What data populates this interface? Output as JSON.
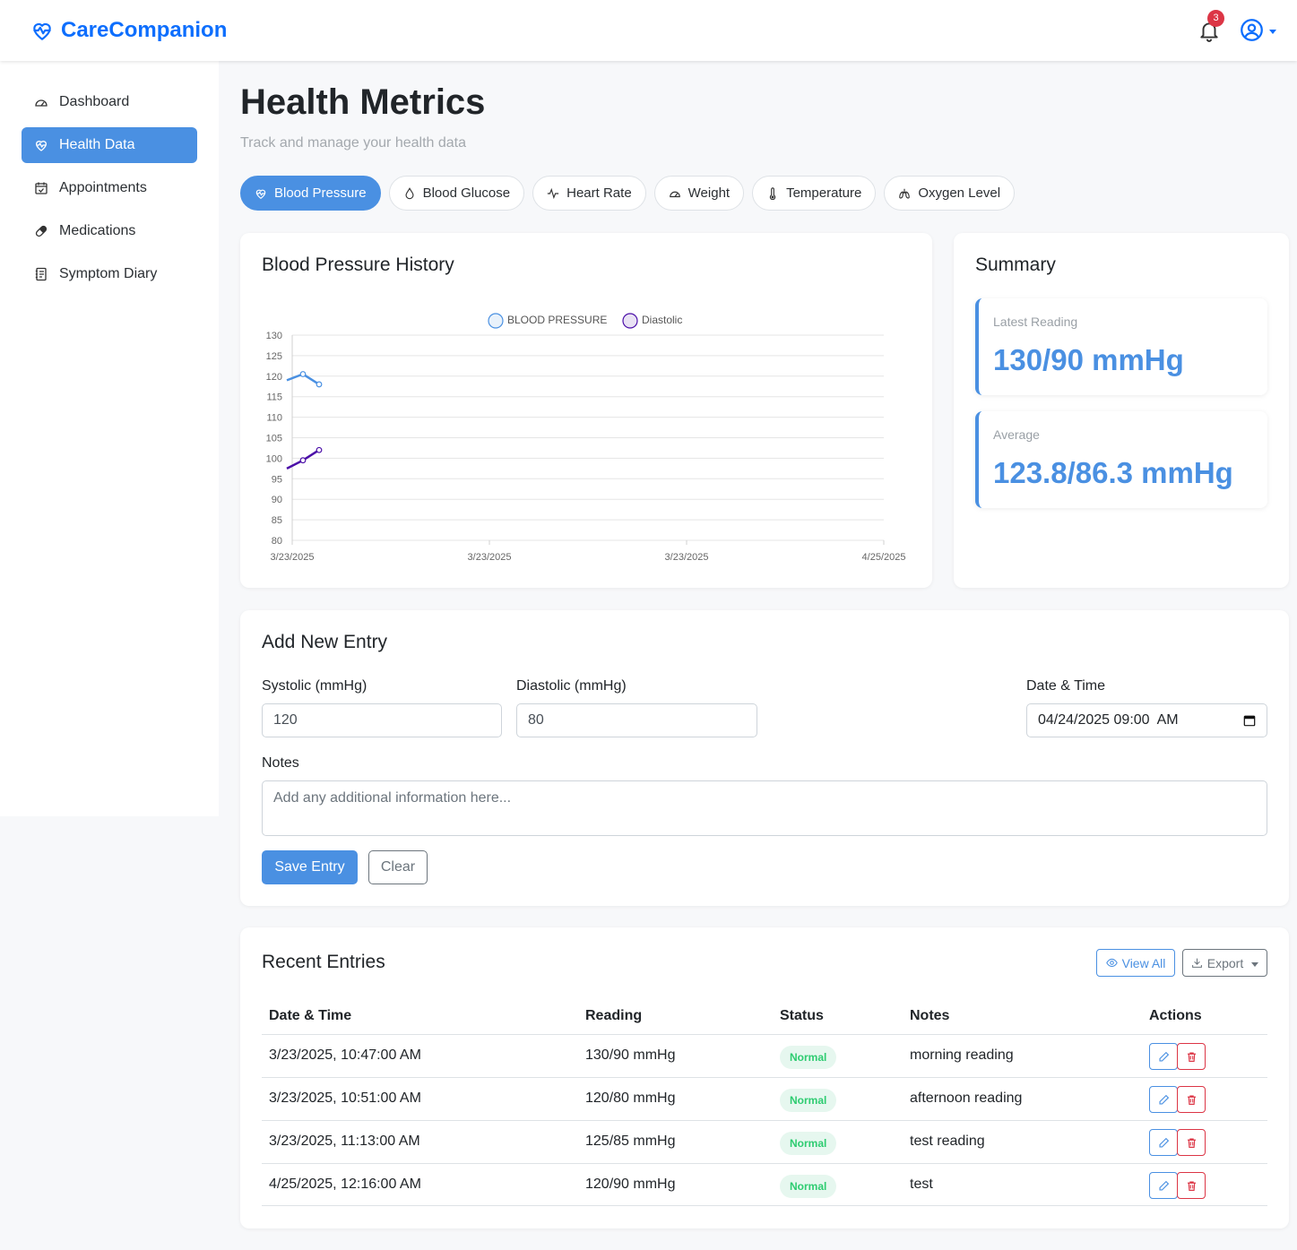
{
  "app": {
    "brand": "CareCompanion",
    "notifications": "3"
  },
  "sidebar": {
    "items": [
      {
        "label": "Dashboard",
        "icon": "gauge-icon"
      },
      {
        "label": "Health Data",
        "icon": "heart-pulse-icon",
        "active": true
      },
      {
        "label": "Appointments",
        "icon": "calendar-check-icon"
      },
      {
        "label": "Medications",
        "icon": "capsule-icon"
      },
      {
        "label": "Symptom Diary",
        "icon": "journal-icon"
      }
    ]
  },
  "page": {
    "title": "Health Metrics",
    "subtitle": "Track and manage your health data"
  },
  "tabs": [
    {
      "label": "Blood Pressure",
      "icon": "heart-pulse-icon",
      "active": true
    },
    {
      "label": "Blood Glucose",
      "icon": "droplet-icon"
    },
    {
      "label": "Heart Rate",
      "icon": "activity-icon"
    },
    {
      "label": "Weight",
      "icon": "speedometer-icon"
    },
    {
      "label": "Temperature",
      "icon": "thermometer-icon"
    },
    {
      "label": "Oxygen Level",
      "icon": "lungs-icon"
    }
  ],
  "history": {
    "title": "Blood Pressure History"
  },
  "chart_data": {
    "type": "line",
    "title": "",
    "x_tick_labels": [
      "3/23/2025",
      "3/23/2025",
      "3/23/2025",
      "4/25/2025"
    ],
    "ylim": [
      80,
      130
    ],
    "yticks": [
      130,
      125,
      120,
      115,
      110,
      105,
      100,
      95,
      90,
      85,
      80
    ],
    "grid": true,
    "legend": "top-center",
    "series": [
      {
        "name": "BLOOD PRESSURE",
        "color": "#4a90e2",
        "values": [
          119,
          120.5,
          118
        ],
        "note_offscreen_start": true
      },
      {
        "name": "Diastolic",
        "color": "#4b0fa8",
        "values": [
          97.5,
          99.5,
          102
        ],
        "note_offscreen_start": true
      }
    ]
  },
  "summary": {
    "title": "Summary",
    "latest_label": "Latest Reading",
    "latest_value": "130/90 mmHg",
    "average_label": "Average",
    "average_value": "123.8/86.3 mmHg"
  },
  "entry": {
    "title": "Add New Entry",
    "systolic_label": "Systolic (mmHg)",
    "systolic_value": "120",
    "diastolic_label": "Diastolic (mmHg)",
    "diastolic_value": "80",
    "datetime_label": "Date & Time",
    "datetime_value": "04/24/2025 09:00  AM",
    "notes_label": "Notes",
    "notes_placeholder": "Add any additional information here...",
    "save_label": "Save Entry",
    "clear_label": "Clear"
  },
  "recent": {
    "title": "Recent Entries",
    "view_all": "View All",
    "export": "Export",
    "columns": [
      "Date & Time",
      "Reading",
      "Status",
      "Notes",
      "Actions"
    ],
    "rows": [
      {
        "datetime": "3/23/2025, 10:47:00 AM",
        "reading": "130/90 mmHg",
        "status": "Normal",
        "notes": "morning reading"
      },
      {
        "datetime": "3/23/2025, 10:51:00 AM",
        "reading": "120/80 mmHg",
        "status": "Normal",
        "notes": "afternoon reading"
      },
      {
        "datetime": "3/23/2025, 11:13:00 AM",
        "reading": "125/85 mmHg",
        "status": "Normal",
        "notes": "test reading"
      },
      {
        "datetime": "4/25/2025, 12:16:00 AM",
        "reading": "120/90 mmHg",
        "status": "Normal",
        "notes": "test"
      }
    ]
  }
}
